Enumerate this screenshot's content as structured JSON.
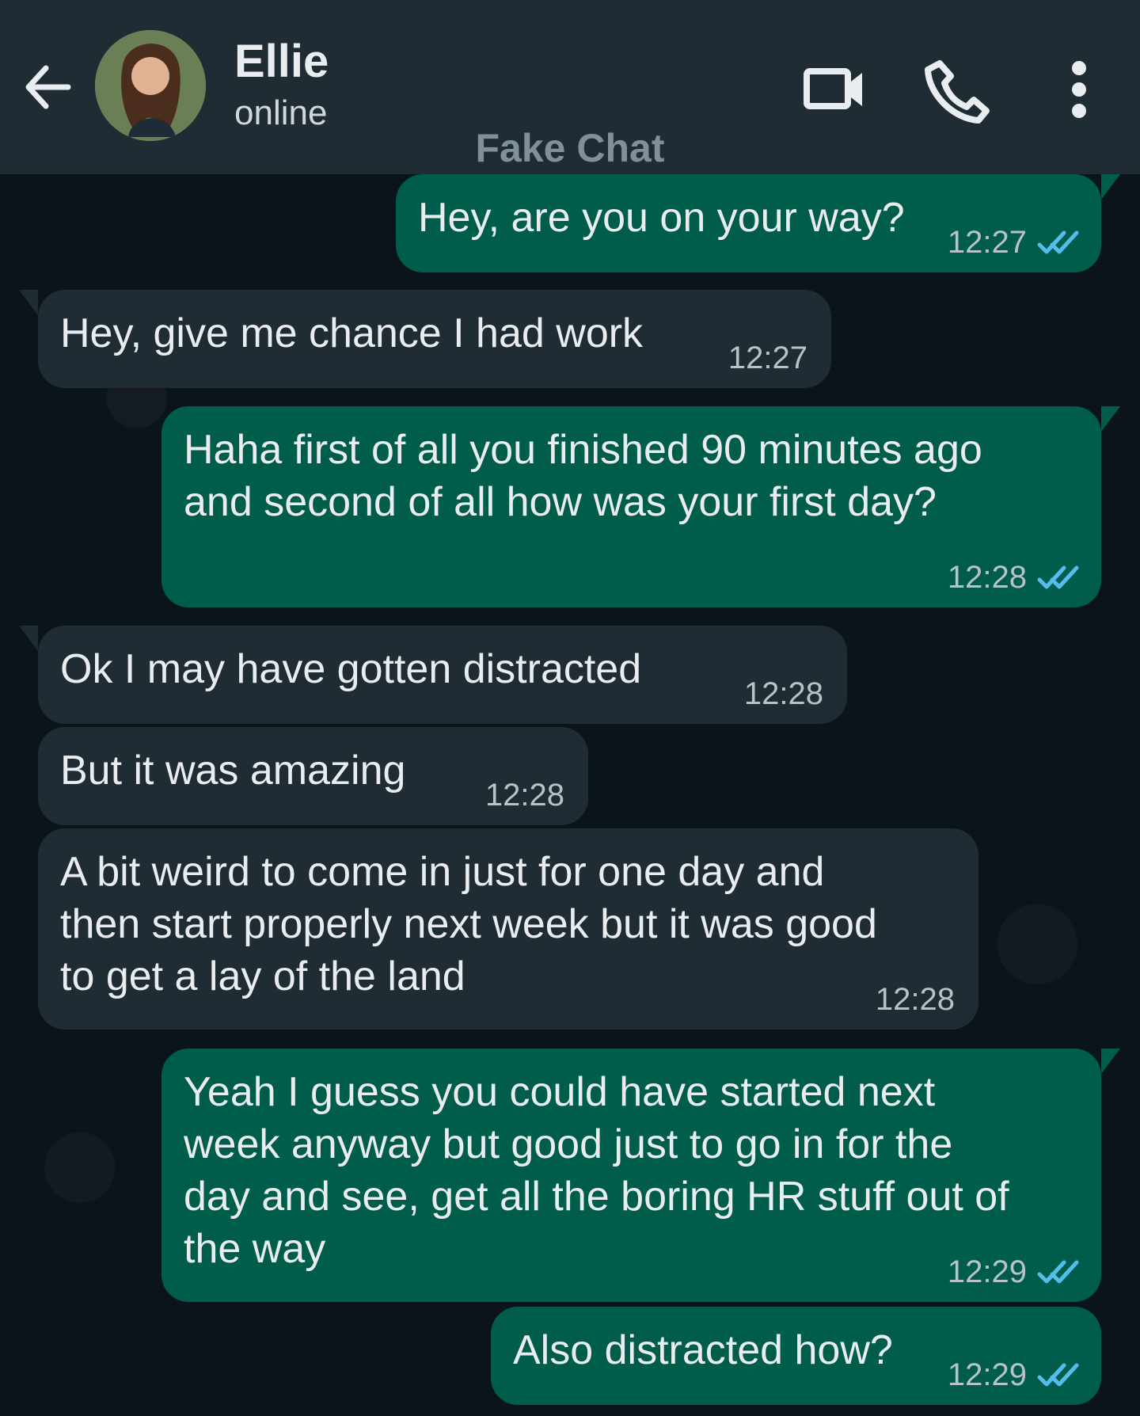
{
  "header": {
    "contact_name": "Ellie",
    "status": "online",
    "watermark": "Fake Chat",
    "icons": [
      "back-arrow-icon",
      "video-call-icon",
      "voice-call-icon",
      "more-options-icon"
    ]
  },
  "messages": [
    {
      "direction": "out",
      "text": "Hey, are you on your way?",
      "time": "12:27",
      "status": "read"
    },
    {
      "direction": "in",
      "text": "Hey, give me chance I had work",
      "time": "12:27"
    },
    {
      "direction": "out",
      "text": "Haha first of all you finished 90 minutes ago\nand second of all how was your first day?",
      "time": "12:28",
      "status": "read"
    },
    {
      "direction": "in",
      "text": "Ok I may have gotten distracted",
      "time": "12:28"
    },
    {
      "direction": "in",
      "text": "But it was amazing",
      "time": "12:28"
    },
    {
      "direction": "in",
      "text": "A bit weird to come in just for one day and\nthen start properly next week but it was good\nto get a lay of the land",
      "time": "12:28"
    },
    {
      "direction": "out",
      "text": "Yeah I guess you could have started next\nweek anyway but good just to go in for the\nday and see, get all the boring HR stuff out of\nthe way",
      "time": "12:29",
      "status": "read"
    },
    {
      "direction": "out",
      "text": "Also distracted how?",
      "time": "12:29",
      "status": "read"
    }
  ],
  "colors": {
    "header": "#1f2c33",
    "background": "#0b141a",
    "incoming_bubble": "#202c33",
    "outgoing_bubble": "#005c4b",
    "read_ticks": "#53bdeb"
  }
}
